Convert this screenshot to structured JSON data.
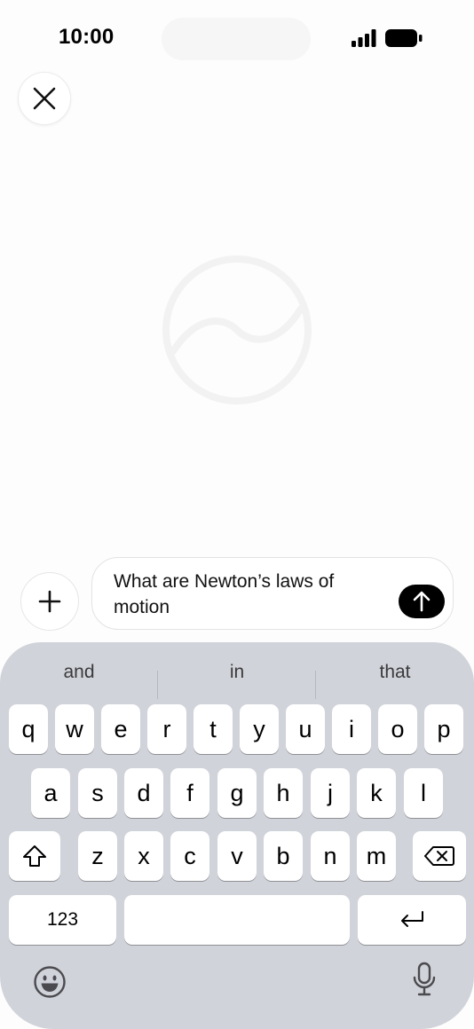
{
  "status_bar": {
    "time": "10:00"
  },
  "composer": {
    "text": "What are Newton’s laws of motion"
  },
  "suggestions": [
    "and",
    "in",
    "that"
  ],
  "keyboard": {
    "row1": [
      "q",
      "w",
      "e",
      "r",
      "t",
      "y",
      "u",
      "i",
      "o",
      "p"
    ],
    "row2": [
      "a",
      "s",
      "d",
      "f",
      "g",
      "h",
      "j",
      "k",
      "l"
    ],
    "row3": [
      "z",
      "x",
      "c",
      "v",
      "b",
      "n",
      "m"
    ],
    "numbers_label": "123"
  },
  "icons": {
    "close": "close-icon",
    "plus": "plus-icon",
    "send": "arrow-up-icon",
    "shift": "shift-icon",
    "backspace": "backspace-icon",
    "return": "return-icon",
    "emoji": "emoji-icon",
    "mic": "mic-icon",
    "logo": "openai-logo-icon"
  },
  "colors": {
    "send_button": "#000000",
    "keyboard_bg": "#d1d3da"
  }
}
